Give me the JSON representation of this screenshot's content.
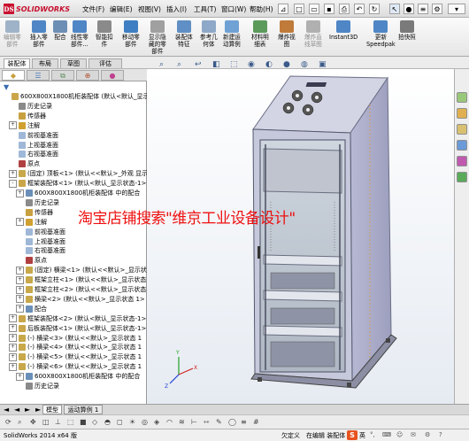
{
  "app": {
    "logo_text": "SOLIDWORKS",
    "logo_mark": "DS"
  },
  "menu": [
    "文件(F)",
    "编辑(E)",
    "视图(V)",
    "插入(I)",
    "工具(T)",
    "窗口(W)",
    "帮助(H)"
  ],
  "command_buttons": [
    {
      "label": "编辑零\n部件",
      "disabled": true,
      "color": "#9fb3c8"
    },
    {
      "label": "插入零\n部件",
      "disabled": false,
      "color": "#4f86c6"
    },
    {
      "label": "配合",
      "disabled": false,
      "color": "#6d8fb5"
    },
    {
      "label": "线性零\n部件...",
      "disabled": false,
      "color": "#4f86c6"
    },
    {
      "label": "智能扣\n件",
      "disabled": false,
      "color": "#8a8a8a"
    },
    {
      "label": "移动零\n部件",
      "disabled": false,
      "color": "#3e7ec2"
    },
    {
      "label": "显示隐\n藏的零\n部件",
      "disabled": false,
      "color": "#a0a0a0"
    },
    {
      "label": "装配体\n特征",
      "disabled": false,
      "color": "#5f8fc4"
    },
    {
      "label": "参考几\n何体",
      "disabled": false,
      "color": "#8da8c8"
    },
    {
      "label": "新建运\n动算例",
      "disabled": false,
      "color": "#6fa1d5"
    },
    {
      "label": "材料明\n细表",
      "disabled": false,
      "color": "#5b9a5b"
    },
    {
      "label": "爆炸视\n图",
      "disabled": false,
      "color": "#c07a3a"
    },
    {
      "label": "爆炸直\n线草图",
      "disabled": true,
      "color": "#b0b0b0"
    },
    {
      "label": "Instant3D",
      "disabled": false,
      "color": "#4f86c6"
    },
    {
      "label": "更新\nSpeedpak",
      "disabled": false,
      "color": "#4f86c6"
    },
    {
      "label": "拍快照",
      "disabled": false,
      "color": "#7a7a7a"
    }
  ],
  "cm_tabs": [
    "装配体",
    "布局",
    "草图",
    "评估"
  ],
  "panel_tabs": [
    "",
    "",
    "",
    "",
    ""
  ],
  "tree": [
    {
      "t": "600X800X1800机柜装配体  (默认<默认_显示",
      "d": 0,
      "exp": "",
      "c": "#caa64a"
    },
    {
      "t": "历史记录",
      "d": 1,
      "exp": "",
      "c": "#8a8a8a"
    },
    {
      "t": "传感器",
      "d": 1,
      "exp": "",
      "c": "#c8a040"
    },
    {
      "t": "注解",
      "d": 1,
      "exp": "+",
      "c": "#d0a030"
    },
    {
      "t": "前视基准面",
      "d": 1,
      "exp": "",
      "c": "#9fb8d8"
    },
    {
      "t": "上视基准面",
      "d": 1,
      "exp": "",
      "c": "#9fb8d8"
    },
    {
      "t": "右视基准面",
      "d": 1,
      "exp": "",
      "c": "#9fb8d8"
    },
    {
      "t": "原点",
      "d": 1,
      "exp": "",
      "c": "#b04040"
    },
    {
      "t": "(固定) 顶板<1> (默认<<默认>_外观 显示",
      "d": 1,
      "exp": "+",
      "c": "#c8a84a"
    },
    {
      "t": "框架装配体<1> (默认<默认_显示状态-1>",
      "d": 1,
      "exp": "-",
      "c": "#caa64a"
    },
    {
      "t": "600X800X1800机柜装配体 中的配合",
      "d": 2,
      "exp": "+",
      "c": "#6a8fb8"
    },
    {
      "t": "历史记录",
      "d": 2,
      "exp": "",
      "c": "#8a8a8a"
    },
    {
      "t": "传感器",
      "d": 2,
      "exp": "",
      "c": "#c8a040"
    },
    {
      "t": "注解",
      "d": 2,
      "exp": "+",
      "c": "#d0a030"
    },
    {
      "t": "前视基准面",
      "d": 2,
      "exp": "",
      "c": "#9fb8d8"
    },
    {
      "t": "上视基准面",
      "d": 2,
      "exp": "",
      "c": "#9fb8d8"
    },
    {
      "t": "右视基准面",
      "d": 2,
      "exp": "",
      "c": "#9fb8d8"
    },
    {
      "t": "原点",
      "d": 2,
      "exp": "",
      "c": "#b04040"
    },
    {
      "t": "(固定) 横梁<1> (默认<<默认>_显示状",
      "d": 2,
      "exp": "+",
      "c": "#c8a84a"
    },
    {
      "t": "框架立柱<1> (默认<<默认>_显示状态",
      "d": 2,
      "exp": "+",
      "c": "#c8a84a"
    },
    {
      "t": "框架立柱<2> (默认<<默认>_显示状态",
      "d": 2,
      "exp": "+",
      "c": "#c8a84a"
    },
    {
      "t": "横梁<2> (默认<<默认>_显示状态 1>",
      "d": 2,
      "exp": "+",
      "c": "#c8a84a"
    },
    {
      "t": "配合",
      "d": 2,
      "exp": "+",
      "c": "#6a8fb8"
    },
    {
      "t": "框架装配体<2> (默认<默认_显示状态-1>",
      "d": 1,
      "exp": "+",
      "c": "#caa64a"
    },
    {
      "t": "后板装配体<1> (默认<默认_显示状态-1>",
      "d": 1,
      "exp": "+",
      "c": "#caa64a"
    },
    {
      "t": "(-) 横梁<3> (默认<<默认>_显示状态 1",
      "d": 1,
      "exp": "+",
      "c": "#c8a84a"
    },
    {
      "t": "(-) 横梁<4> (默认<<默认>_显示状态 1",
      "d": 1,
      "exp": "+",
      "c": "#c8a84a"
    },
    {
      "t": "(-) 横梁<5> (默认<<默认>_显示状态 1",
      "d": 1,
      "exp": "+",
      "c": "#c8a84a"
    },
    {
      "t": "(-) 横梁<6> (默认<<默认>_显示状态 1",
      "d": 1,
      "exp": "+",
      "c": "#c8a84a"
    },
    {
      "t": "600X800X1800机柜装配体 中的配合",
      "d": 2,
      "exp": "+",
      "c": "#6a8fb8"
    },
    {
      "t": "历史记录",
      "d": 2,
      "exp": "",
      "c": "#8a8a8a"
    }
  ],
  "watermark": "淘宝店铺搜索\"维京工业设备设计\"",
  "bottom_tabs": [
    "模型",
    "运动算例 1"
  ],
  "status": {
    "left": "SolidWorks 2014 x64 版",
    "mid1": "欠定义",
    "mid2": "在编辑 装配体",
    "right_ime": "英"
  }
}
